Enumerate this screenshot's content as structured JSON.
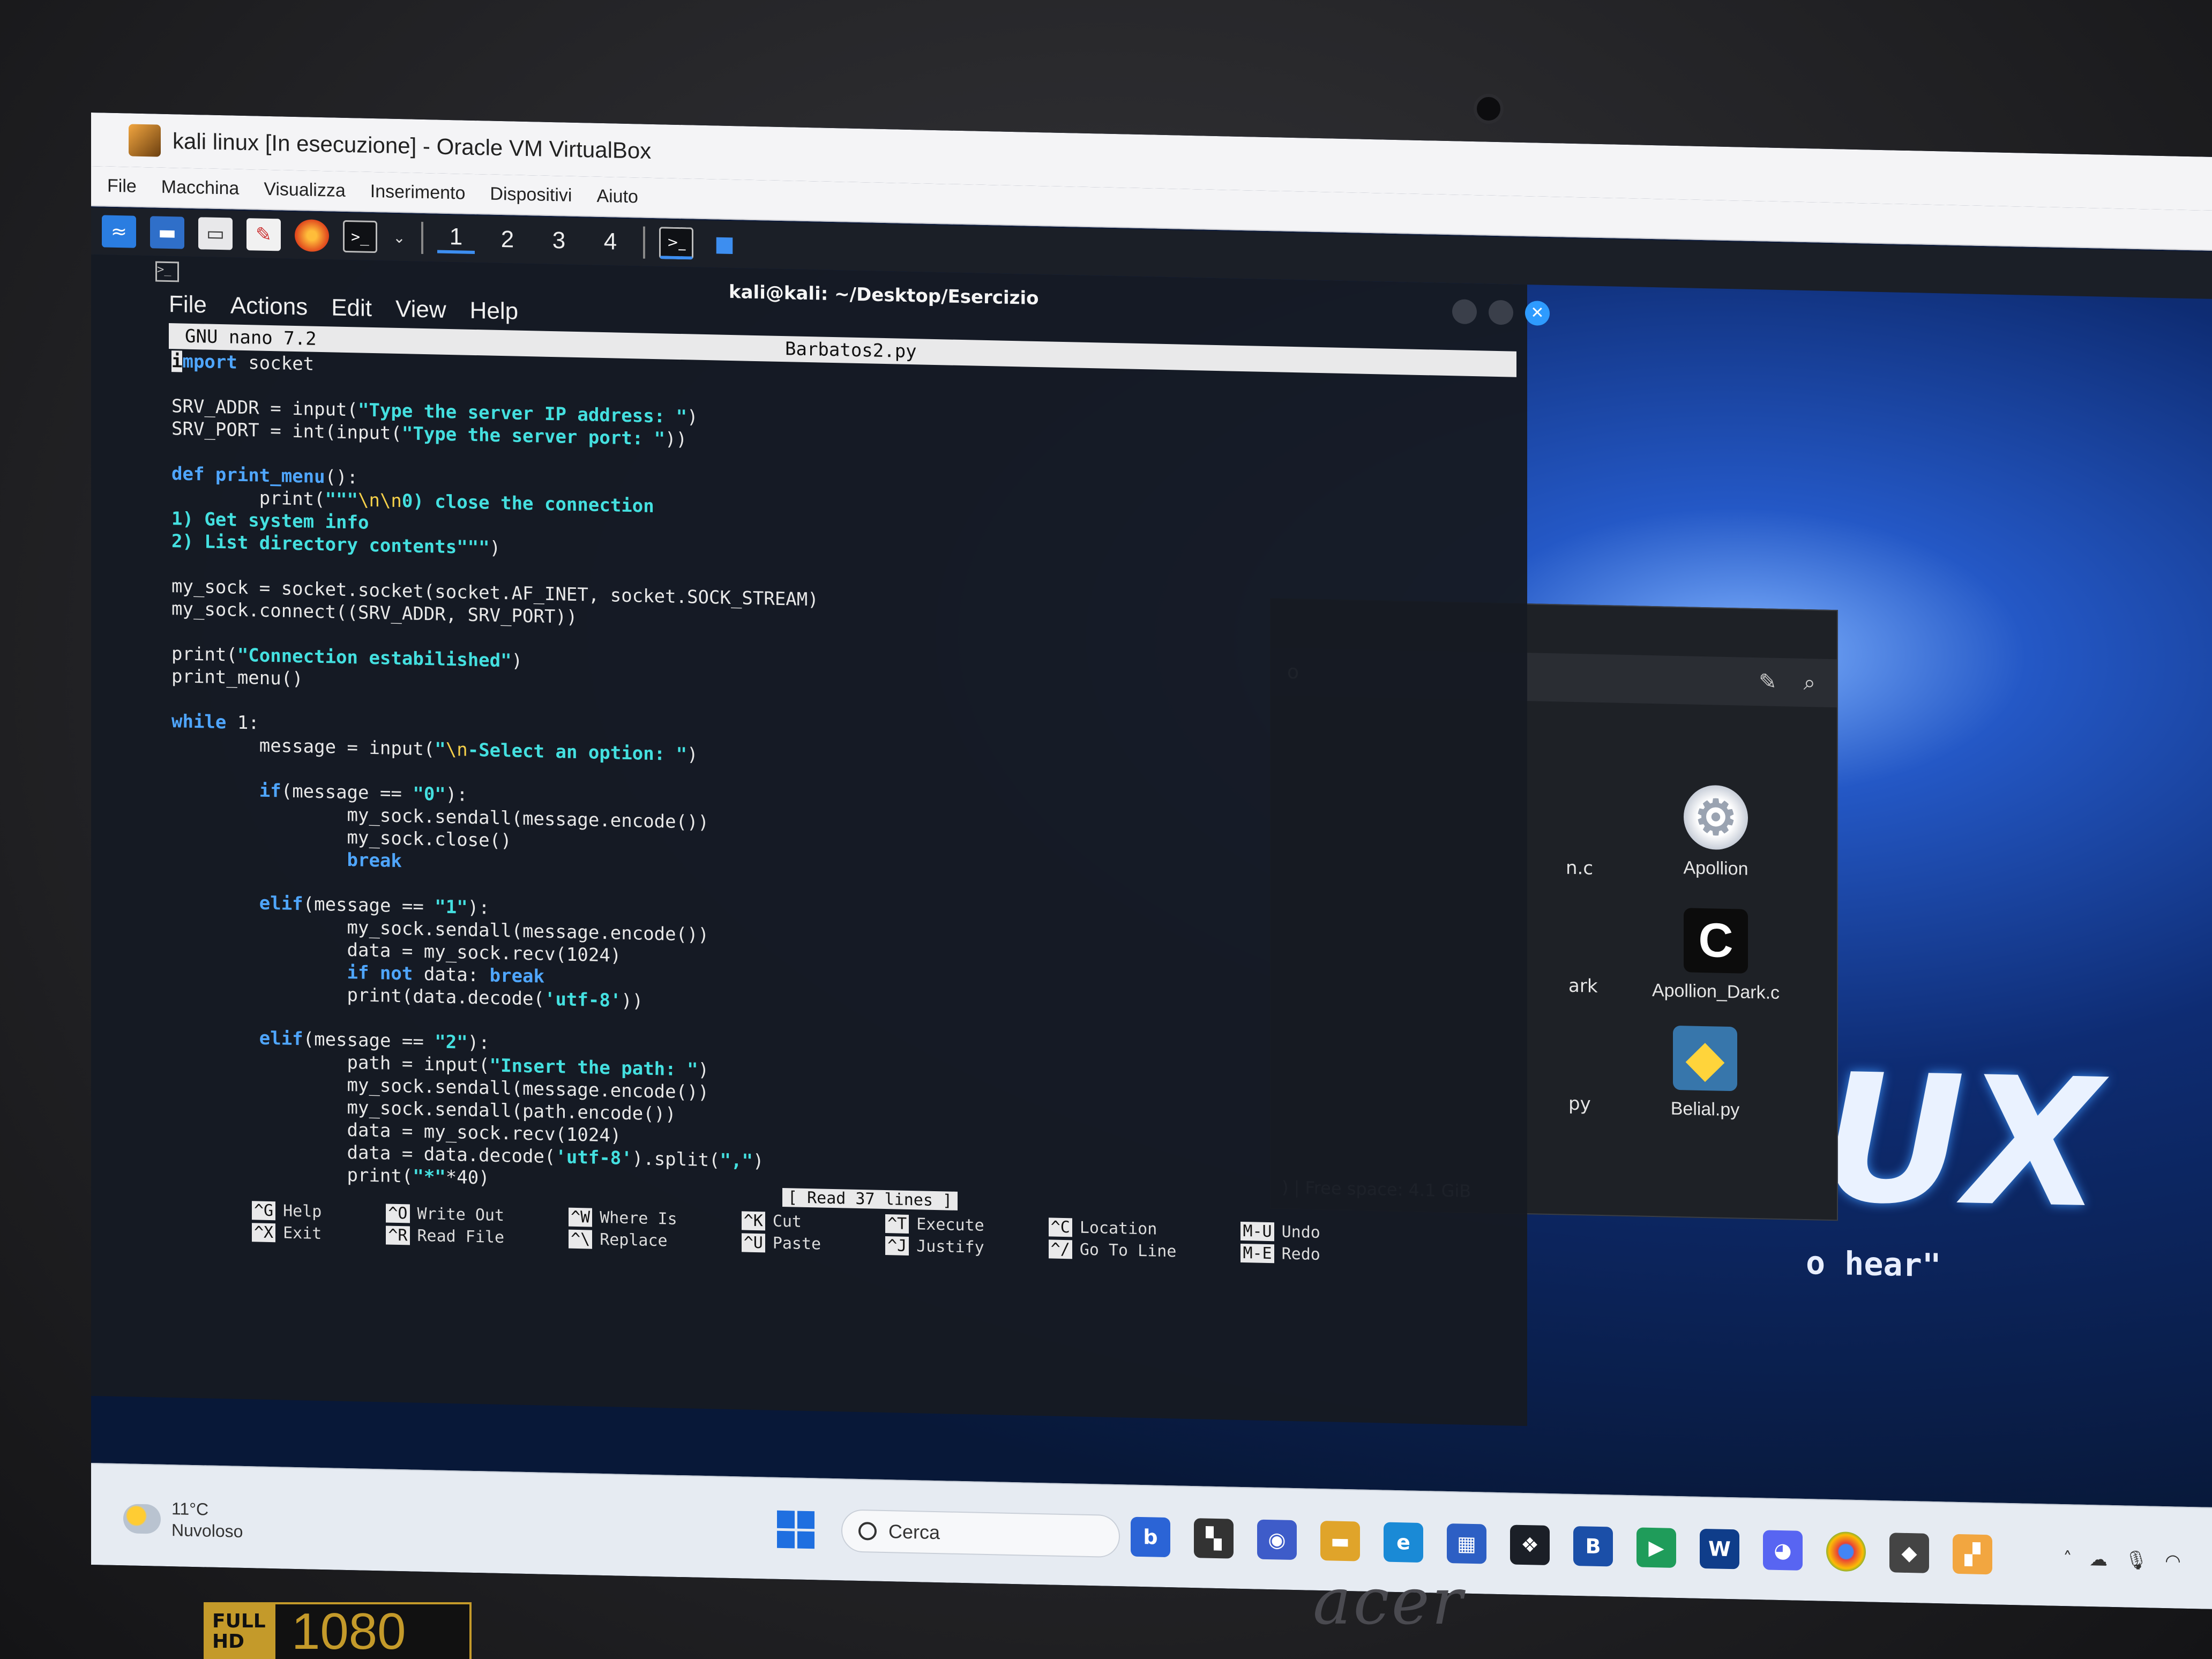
{
  "window": {
    "title": "kali linux [In esecuzione] - Oracle VM VirtualBox",
    "menu": [
      "File",
      "Macchina",
      "Visualizza",
      "Inserimento",
      "Dispositivi",
      "Aiuto"
    ]
  },
  "kali_panel": {
    "workspaces": [
      "1",
      "2",
      "3",
      "4"
    ],
    "active_workspace": "1"
  },
  "terminal": {
    "title": "kali@kali: ~/Desktop/Esercizio",
    "menu": [
      "File",
      "Actions",
      "Edit",
      "View",
      "Help"
    ]
  },
  "nano": {
    "version": "GNU nano 7.2",
    "filename": "Barbatos2.py",
    "status": "[ Read 37 lines ]",
    "shortcuts": [
      {
        "k1": "^G",
        "l1": "Help",
        "k2": "^X",
        "l2": "Exit"
      },
      {
        "k1": "^O",
        "l1": "Write Out",
        "k2": "^R",
        "l2": "Read File"
      },
      {
        "k1": "^W",
        "l1": "Where Is",
        "k2": "^\\",
        "l2": "Replace"
      },
      {
        "k1": "^K",
        "l1": "Cut",
        "k2": "^U",
        "l2": "Paste"
      },
      {
        "k1": "^T",
        "l1": "Execute",
        "k2": "^J",
        "l2": "Justify"
      },
      {
        "k1": "^C",
        "l1": "Location",
        "k2": "^/",
        "l2": "Go To Line"
      },
      {
        "k1": "M-U",
        "l1": "Undo",
        "k2": "M-E",
        "l2": "Redo"
      }
    ]
  },
  "file_manager": {
    "items": [
      {
        "name": "Apollion",
        "icon": "gear-icon"
      },
      {
        "name": "Apollion_Dark.c",
        "icon": "c-source-icon"
      },
      {
        "name": "Belial.py",
        "icon": "python-icon"
      }
    ],
    "partial_labels": [
      "o",
      "n.c",
      "ark",
      "py"
    ],
    "status": ") | Free space: 4.1 GiB"
  },
  "wallpaper": {
    "logo_fragment": "UX",
    "quote_fragment": "o hear\""
  },
  "taskbar": {
    "weather_temp": "11°C",
    "weather_desc": "Nuvoloso",
    "search_placeholder": "Cerca"
  },
  "bezel": {
    "brand": "acer",
    "sticker_top": "FULL",
    "sticker_bottom": "HD",
    "sticker_number": "1080"
  }
}
